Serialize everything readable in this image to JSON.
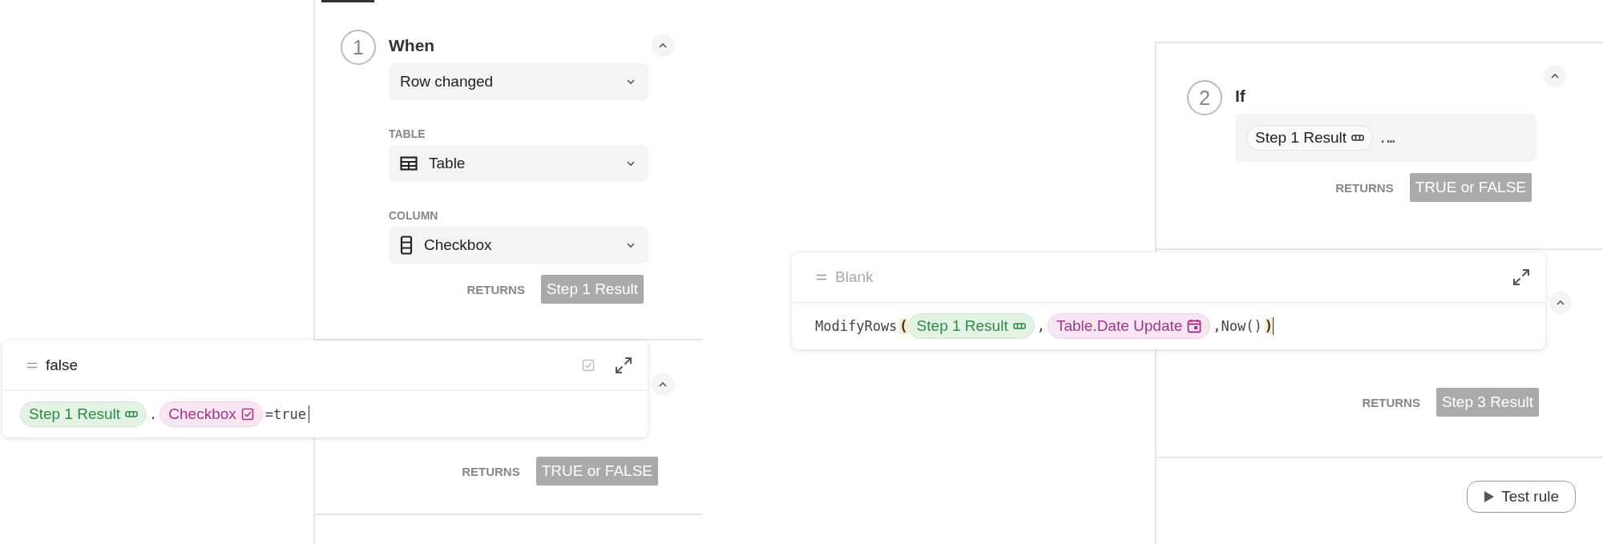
{
  "left": {
    "step": {
      "number": "1",
      "title": "When",
      "trigger": "Row changed",
      "fields": [
        {
          "kind": "table",
          "label": "TABLE",
          "value": "Table"
        },
        {
          "kind": "column",
          "label": "COLUMN",
          "value": "Checkbox"
        }
      ],
      "returns_label": "RETURNS",
      "returns": "Step 1 Result"
    },
    "next_step": {
      "returns_label": "RETURNS",
      "returns": "TRUE or FALSE"
    },
    "formula_popup": {
      "result": "false",
      "tokens": [
        {
          "kind": "result",
          "text": "Step 1 Result"
        },
        {
          "kind": "code",
          "text": "."
        },
        {
          "kind": "checkbox-column",
          "text": "Checkbox"
        },
        {
          "kind": "code",
          "text": "=true"
        }
      ]
    }
  },
  "right": {
    "step": {
      "number": "2",
      "title": "If",
      "tokens": [
        {
          "kind": "ref",
          "text": "Step 1 Result"
        },
        {
          "kind": "code",
          "text": ".…"
        }
      ],
      "returns_label": "RETURNS",
      "returns": "TRUE or FALSE"
    },
    "next_step": {
      "returns_label": "RETURNS",
      "returns": "Step 3 Result"
    },
    "formula_popup": {
      "placeholder": "Blank",
      "tokens": [
        {
          "kind": "code",
          "text": "ModifyRows"
        },
        {
          "kind": "paren",
          "text": "("
        },
        {
          "kind": "result",
          "text": "Step 1 Result"
        },
        {
          "kind": "code",
          "text": ","
        },
        {
          "kind": "date-column",
          "text": "Table.Date Update"
        },
        {
          "kind": "code",
          "text": ",Now()"
        },
        {
          "kind": "paren",
          "text": ")"
        }
      ]
    },
    "test_button": "Test rule"
  }
}
